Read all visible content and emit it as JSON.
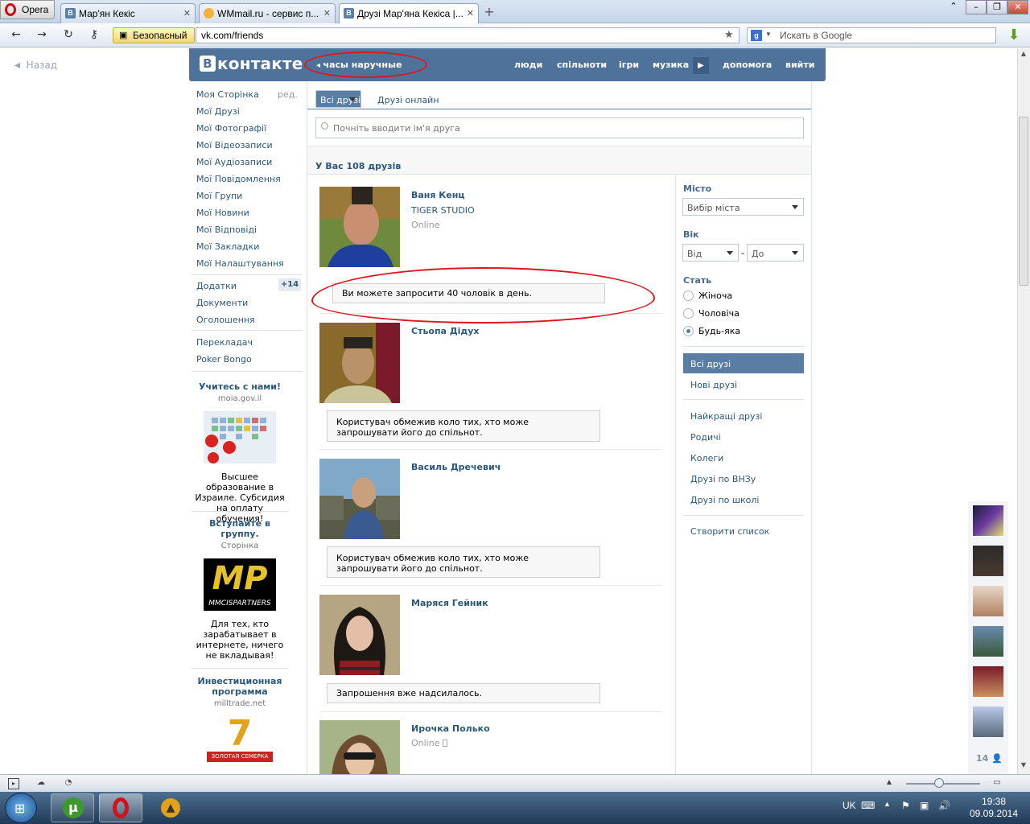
{
  "browser": {
    "menu_label": "Opera",
    "tabs": [
      {
        "label": "Мар'ян Кекіс",
        "favicon": "В"
      },
      {
        "label": "WMmail.ru - сервис п...",
        "favicon": ""
      },
      {
        "label": "Друзі Мар'яна Кекіса |...",
        "favicon": "В"
      }
    ],
    "secure_label": "Безопасный",
    "url": "vk.com/friends",
    "search_placeholder": "Искать в Google",
    "search_engine_letter": "g"
  },
  "page": {
    "back_label": "Назад",
    "header": {
      "logo": "контакте",
      "logo_badge": "В",
      "crumb": "часы наручные",
      "nav": [
        "люди",
        "спільноти",
        "ігри",
        "музика",
        "допомога",
        "вийти"
      ]
    },
    "left_menu": {
      "items": [
        "Моя Сторінка",
        "Мої Друзі",
        "Мої Фотографії",
        "Мої Відеозаписи",
        "Мої Аудіозаписи",
        "Мої Повідомлення",
        "Мої Групи",
        "Мої Новини",
        "Мої Відповіді",
        "Мої Закладки",
        "Мої Налаштування"
      ],
      "edit_label": "ред.",
      "apps": "Додатки",
      "apps_count": "+14",
      "docs": "Документи",
      "ads": "Оголошення",
      "extra": [
        "Перекладач",
        "Poker Bongo"
      ]
    },
    "ads": [
      {
        "title": "Учитесь с нами!",
        "sub": "moia.gov.il",
        "text": "Высшее образование в Израиле. Субсидия на оплату обучения!"
      },
      {
        "title": "Вступайте в группу.",
        "sub": "Сторінка",
        "text": "Для тех, кто зарабатывает в интернете, ничего не вкладывая!",
        "logo": "MP",
        "logo_sub": "MMCISPARTNERS"
      },
      {
        "title": "Инвестиционная программа",
        "sub": "milltrade.net",
        "logo": "7",
        "logo_sub": "ЗОЛОТАЯ СЕМЕРКА"
      }
    ],
    "tabs": {
      "all": "Всі друзі",
      "online": "Друзі онлайн"
    },
    "search_placeholder": "Почніть вводити ім'я друга",
    "count_text": "У Вас 108 друзів",
    "friends": [
      {
        "name": "Ваня Кенц",
        "sub": "TIGER STUDIO",
        "status": "Online",
        "notice": "Ви можете запросити 40 чоловік в день."
      },
      {
        "name": "Стьопа Дідух",
        "notice": "Користувач обмежив коло тих, хто може запрошувати його до спільнот."
      },
      {
        "name": "Василь Дречевич",
        "notice": "Користувач обмежив коло тих, хто може запрошувати його до спільнот."
      },
      {
        "name": "Маряся Гейник",
        "notice": "Запрошення вже надсилалось."
      },
      {
        "name": "Ирочка Полько",
        "status": "Online"
      }
    ],
    "filters": {
      "city_label": "Місто",
      "city_select": "Вибір міста",
      "age_label": "Вік",
      "age_from": "Від",
      "age_dash": "-",
      "age_to": "До",
      "sex_label": "Стать",
      "sex_options": [
        "Жіноча",
        "Чоловіча",
        "Будь-яка"
      ],
      "sex_selected_index": 2,
      "nav": [
        "Всі друзі",
        "Нові друзі",
        "Найкращі друзі",
        "Родичі",
        "Колеги",
        "Друзі по ВНЗу",
        "Друзі по школі",
        "Створити список"
      ]
    },
    "online_count": "14"
  },
  "taskbar": {
    "lang": "UK",
    "time": "19:38",
    "date": "09.09.2014"
  },
  "colors": {
    "vk_header": "#4e729a",
    "vk_link": "#2b587a",
    "annotation": "#e0161e",
    "tab_selected": "#597da3"
  }
}
